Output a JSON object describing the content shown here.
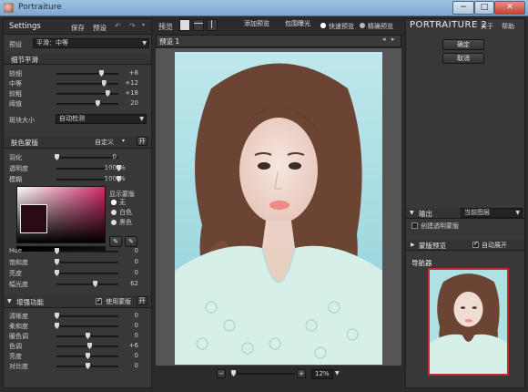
{
  "window": {
    "title": "Portraiture",
    "minimize": "−",
    "maximize": "□",
    "close": "✕"
  },
  "left": {
    "header": {
      "title": "Settings",
      "save": "保存",
      "preset": "预设"
    },
    "preset_row": {
      "label": "预设",
      "value": "平滑：中等"
    },
    "detail": {
      "title": "细节平滑",
      "sliders": [
        {
          "label": "较细",
          "value": "+8",
          "pos": 0.72
        },
        {
          "label": "中等",
          "value": "+12",
          "pos": 0.76
        },
        {
          "label": "较粗",
          "value": "+18",
          "pos": 0.82
        },
        {
          "label": "阈值",
          "value": "20",
          "pos": 0.66
        }
      ],
      "patch_label": "斑块大小",
      "patch_value": "自动检测"
    },
    "mask": {
      "title": "肤色蒙版",
      "mode": "自定义",
      "toggle": "开",
      "sliders": [
        {
          "label": "羽化",
          "value": "0",
          "pos": 0.0
        },
        {
          "label": "透明度",
          "value": "100",
          "unit": "%",
          "pos": 1.0
        },
        {
          "label": "模糊",
          "value": "100",
          "unit": "%",
          "pos": 1.0
        }
      ],
      "show_mask_label": "显示蒙版",
      "radios": [
        "无",
        "白色",
        "黑色"
      ],
      "hsl": [
        {
          "label": "Hue",
          "value": "0",
          "pos": 0.0
        },
        {
          "label": "饱和度",
          "value": "0",
          "pos": 0.0
        },
        {
          "label": "亮度",
          "value": "0",
          "pos": 0.0
        },
        {
          "label": "幅光度",
          "value": "62",
          "pos": 0.62
        }
      ]
    },
    "enhance": {
      "title": "增强功能",
      "use_mask": "使用蒙版",
      "toggle": "开",
      "sliders": [
        {
          "label": "清晰度",
          "value": "0",
          "pos": 0.0
        },
        {
          "label": "柔和度",
          "value": "0",
          "pos": 0.0
        },
        {
          "label": "暖色调",
          "value": "0",
          "pos": 0.5
        },
        {
          "label": "色调",
          "value": "+6",
          "pos": 0.53
        },
        {
          "label": "亮度",
          "value": "0",
          "pos": 0.5
        },
        {
          "label": "对比度",
          "value": "0",
          "pos": 0.5
        }
      ]
    }
  },
  "center": {
    "toolbar": {
      "preview": "预览",
      "add_preview": "添加预览",
      "clip_exposure": "包围曝光",
      "fast_preview": "快速预览",
      "precise_preview": "精确预览"
    },
    "tab": "预览 1",
    "zoom": {
      "minus": "−",
      "plus": "+",
      "value": "12%"
    }
  },
  "right": {
    "brand": "PORTRAITURE 2",
    "about": "关于",
    "help": "帮助",
    "ok": "确定",
    "cancel": "取消",
    "output": {
      "title": "输出",
      "value": "当前图层",
      "create_mask": "创建透明蒙版"
    },
    "mask_preview": {
      "title": "蒙版预览",
      "auto_expand": "自动展开"
    },
    "navigator": {
      "title": "导航器"
    }
  },
  "colors": {
    "accent_pink": "#d22a6a",
    "bg": "#2b2b2b",
    "panel": "#383838",
    "photo_bg": "#aee0e4"
  }
}
